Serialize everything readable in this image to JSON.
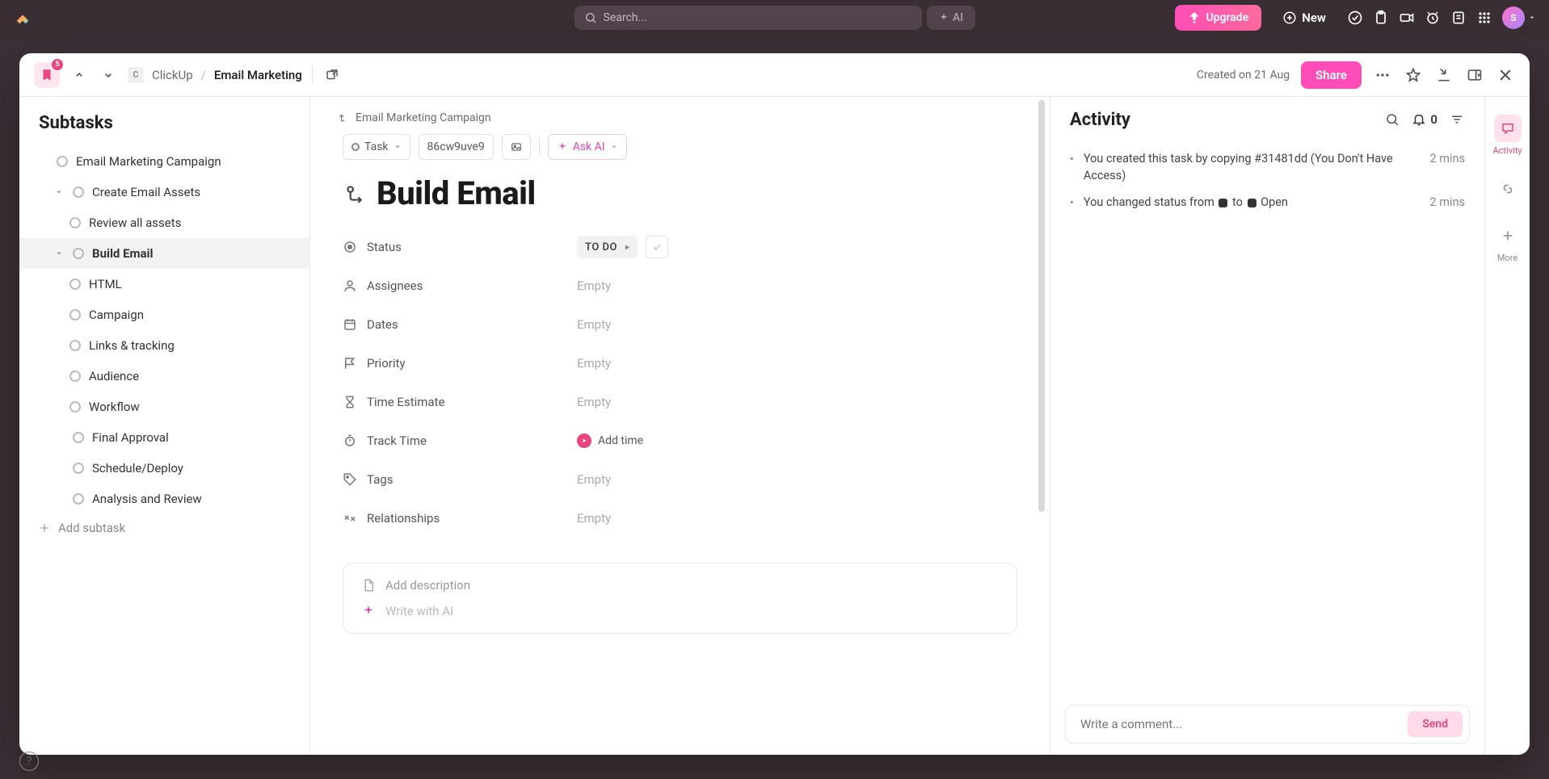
{
  "topbar": {
    "search_placeholder": "Search...",
    "ai_label": "AI",
    "upgrade_label": "Upgrade",
    "new_label": "New",
    "avatar_initial": "S"
  },
  "header": {
    "badge": "5",
    "breadcrumb_space": "ClickUp",
    "breadcrumb_location": "Email Marketing",
    "created_meta": "Created on 21 Aug",
    "share_label": "Share"
  },
  "subtasks": {
    "title": "Subtasks",
    "items": [
      {
        "label": "Email Marketing Campaign",
        "indent": 0,
        "caret": false
      },
      {
        "label": "Create Email Assets",
        "indent": 1,
        "caret": true
      },
      {
        "label": "Review all assets",
        "indent": 2,
        "caret": false
      },
      {
        "label": "Build Email",
        "indent": 1,
        "caret": true,
        "active": true
      },
      {
        "label": "HTML",
        "indent": 2,
        "caret": false
      },
      {
        "label": "Campaign",
        "indent": 2,
        "caret": false
      },
      {
        "label": "Links & tracking",
        "indent": 2,
        "caret": false
      },
      {
        "label": "Audience",
        "indent": 2,
        "caret": false
      },
      {
        "label": "Workflow",
        "indent": 2,
        "caret": false
      },
      {
        "label": "Final Approval",
        "indent": 1,
        "caret": false
      },
      {
        "label": "Schedule/Deploy",
        "indent": 1,
        "caret": false
      },
      {
        "label": "Analysis and Review",
        "indent": 1,
        "caret": false
      }
    ],
    "add_label": "Add subtask"
  },
  "main": {
    "parent_link": "Email Marketing Campaign",
    "task_type": "Task",
    "task_id": "86cw9uve9",
    "ask_ai": "Ask AI",
    "title": "Build Email",
    "fields": {
      "status_label": "Status",
      "status_value": "TO DO",
      "assignees_label": "Assignees",
      "dates_label": "Dates",
      "priority_label": "Priority",
      "time_est_label": "Time Estimate",
      "track_time_label": "Track Time",
      "add_time": "Add time",
      "tags_label": "Tags",
      "relationships_label": "Relationships",
      "empty": "Empty"
    },
    "desc_placeholder": "Add description",
    "write_ai": "Write with AI"
  },
  "activity": {
    "title": "Activity",
    "notif_count": "0",
    "items": [
      {
        "text_a": "You created this task by copying #31481dd (You Don't Have Access)",
        "status_change": false,
        "time": "2 mins"
      },
      {
        "text_a": "You changed status from ",
        "text_b": " to ",
        "text_c": " Open",
        "status_change": true,
        "time": "2 mins"
      }
    ],
    "comment_placeholder": "Write a comment...",
    "send_label": "Send"
  },
  "rail": {
    "activity_label": "Activity",
    "more_label": "More"
  }
}
